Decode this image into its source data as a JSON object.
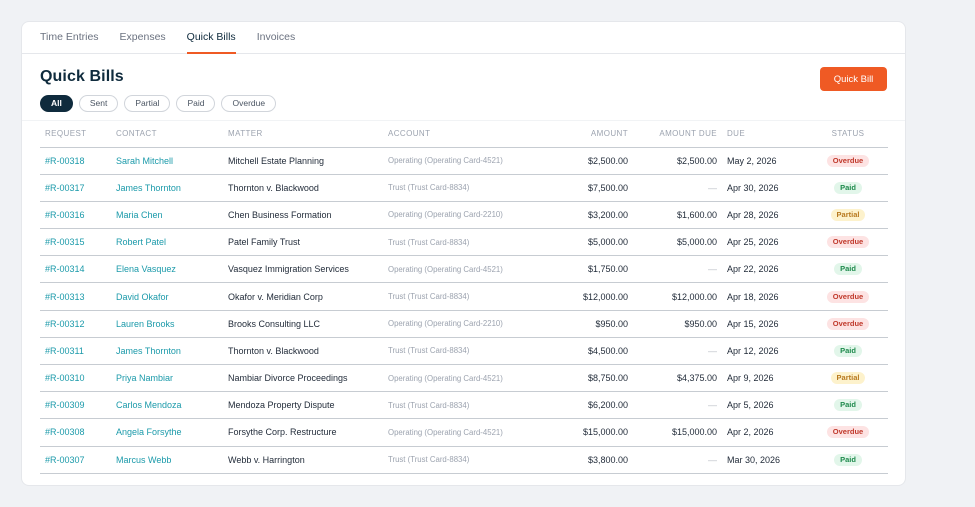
{
  "tabs": [
    {
      "label": "Time Entries"
    },
    {
      "label": "Expenses"
    },
    {
      "label": "Quick Bills"
    },
    {
      "label": "Invoices"
    }
  ],
  "active_tab": "Quick Bills",
  "header": {
    "title": "Quick Bills",
    "primary_button": "Quick Bill"
  },
  "filters": [
    {
      "label": "All"
    },
    {
      "label": "Sent"
    },
    {
      "label": "Partial"
    },
    {
      "label": "Paid"
    },
    {
      "label": "Overdue"
    }
  ],
  "active_filter": "All",
  "table": {
    "columns": [
      "REQUEST",
      "CONTACT",
      "MATTER",
      "ACCOUNT",
      "AMOUNT",
      "AMOUNT DUE",
      "DUE",
      "STATUS"
    ],
    "rows": [
      {
        "request": "#R-00318",
        "contact": "Sarah Mitchell",
        "matter": "Mitchell Estate Planning",
        "account": "Operating (Operating Card-4521)",
        "amount": "$2,500.00",
        "amount_due": "$2,500.00",
        "due": "May 2, 2026",
        "status": "Overdue"
      },
      {
        "request": "#R-00317",
        "contact": "James Thornton",
        "matter": "Thornton v. Blackwood",
        "account": "Trust (Trust Card-8834)",
        "amount": "$7,500.00",
        "amount_due": "—",
        "due": "Apr 30, 2026",
        "status": "Paid"
      },
      {
        "request": "#R-00316",
        "contact": "Maria Chen",
        "matter": "Chen Business Formation",
        "account": "Operating (Operating Card-2210)",
        "amount": "$3,200.00",
        "amount_due": "$1,600.00",
        "due": "Apr 28, 2026",
        "status": "Partial"
      },
      {
        "request": "#R-00315",
        "contact": "Robert Patel",
        "matter": "Patel Family Trust",
        "account": "Trust (Trust Card-8834)",
        "amount": "$5,000.00",
        "amount_due": "$5,000.00",
        "due": "Apr 25, 2026",
        "status": "Overdue"
      },
      {
        "request": "#R-00314",
        "contact": "Elena Vasquez",
        "matter": "Vasquez Immigration Services",
        "account": "Operating (Operating Card-4521)",
        "amount": "$1,750.00",
        "amount_due": "—",
        "due": "Apr 22, 2026",
        "status": "Paid"
      },
      {
        "request": "#R-00313",
        "contact": "David Okafor",
        "matter": "Okafor v. Meridian Corp",
        "account": "Trust (Trust Card-8834)",
        "amount": "$12,000.00",
        "amount_due": "$12,000.00",
        "due": "Apr 18, 2026",
        "status": "Overdue"
      },
      {
        "request": "#R-00312",
        "contact": "Lauren Brooks",
        "matter": "Brooks Consulting LLC",
        "account": "Operating (Operating Card-2210)",
        "amount": "$950.00",
        "amount_due": "$950.00",
        "due": "Apr 15, 2026",
        "status": "Overdue"
      },
      {
        "request": "#R-00311",
        "contact": "James Thornton",
        "matter": "Thornton v. Blackwood",
        "account": "Trust (Trust Card-8834)",
        "amount": "$4,500.00",
        "amount_due": "—",
        "due": "Apr 12, 2026",
        "status": "Paid"
      },
      {
        "request": "#R-00310",
        "contact": "Priya Nambiar",
        "matter": "Nambiar Divorce Proceedings",
        "account": "Operating (Operating Card-4521)",
        "amount": "$8,750.00",
        "amount_due": "$4,375.00",
        "due": "Apr 9, 2026",
        "status": "Partial"
      },
      {
        "request": "#R-00309",
        "contact": "Carlos Mendoza",
        "matter": "Mendoza Property Dispute",
        "account": "Trust (Trust Card-8834)",
        "amount": "$6,200.00",
        "amount_due": "—",
        "due": "Apr 5, 2026",
        "status": "Paid"
      },
      {
        "request": "#R-00308",
        "contact": "Angela Forsythe",
        "matter": "Forsythe Corp. Restructure",
        "account": "Operating (Operating Card-4521)",
        "amount": "$15,000.00",
        "amount_due": "$15,000.00",
        "due": "Apr 2, 2026",
        "status": "Overdue"
      },
      {
        "request": "#R-00307",
        "contact": "Marcus Webb",
        "matter": "Webb v. Harrington",
        "account": "Trust (Trust Card-8834)",
        "amount": "$3,800.00",
        "amount_due": "—",
        "due": "Mar 30, 2026",
        "status": "Paid"
      }
    ]
  },
  "colors": {
    "accent": "#ef5a24",
    "title": "#0f2b3d",
    "link": "#1b9aaa",
    "overdue": "#c0392b",
    "paid": "#1e8a4c",
    "partial": "#b7791f"
  }
}
